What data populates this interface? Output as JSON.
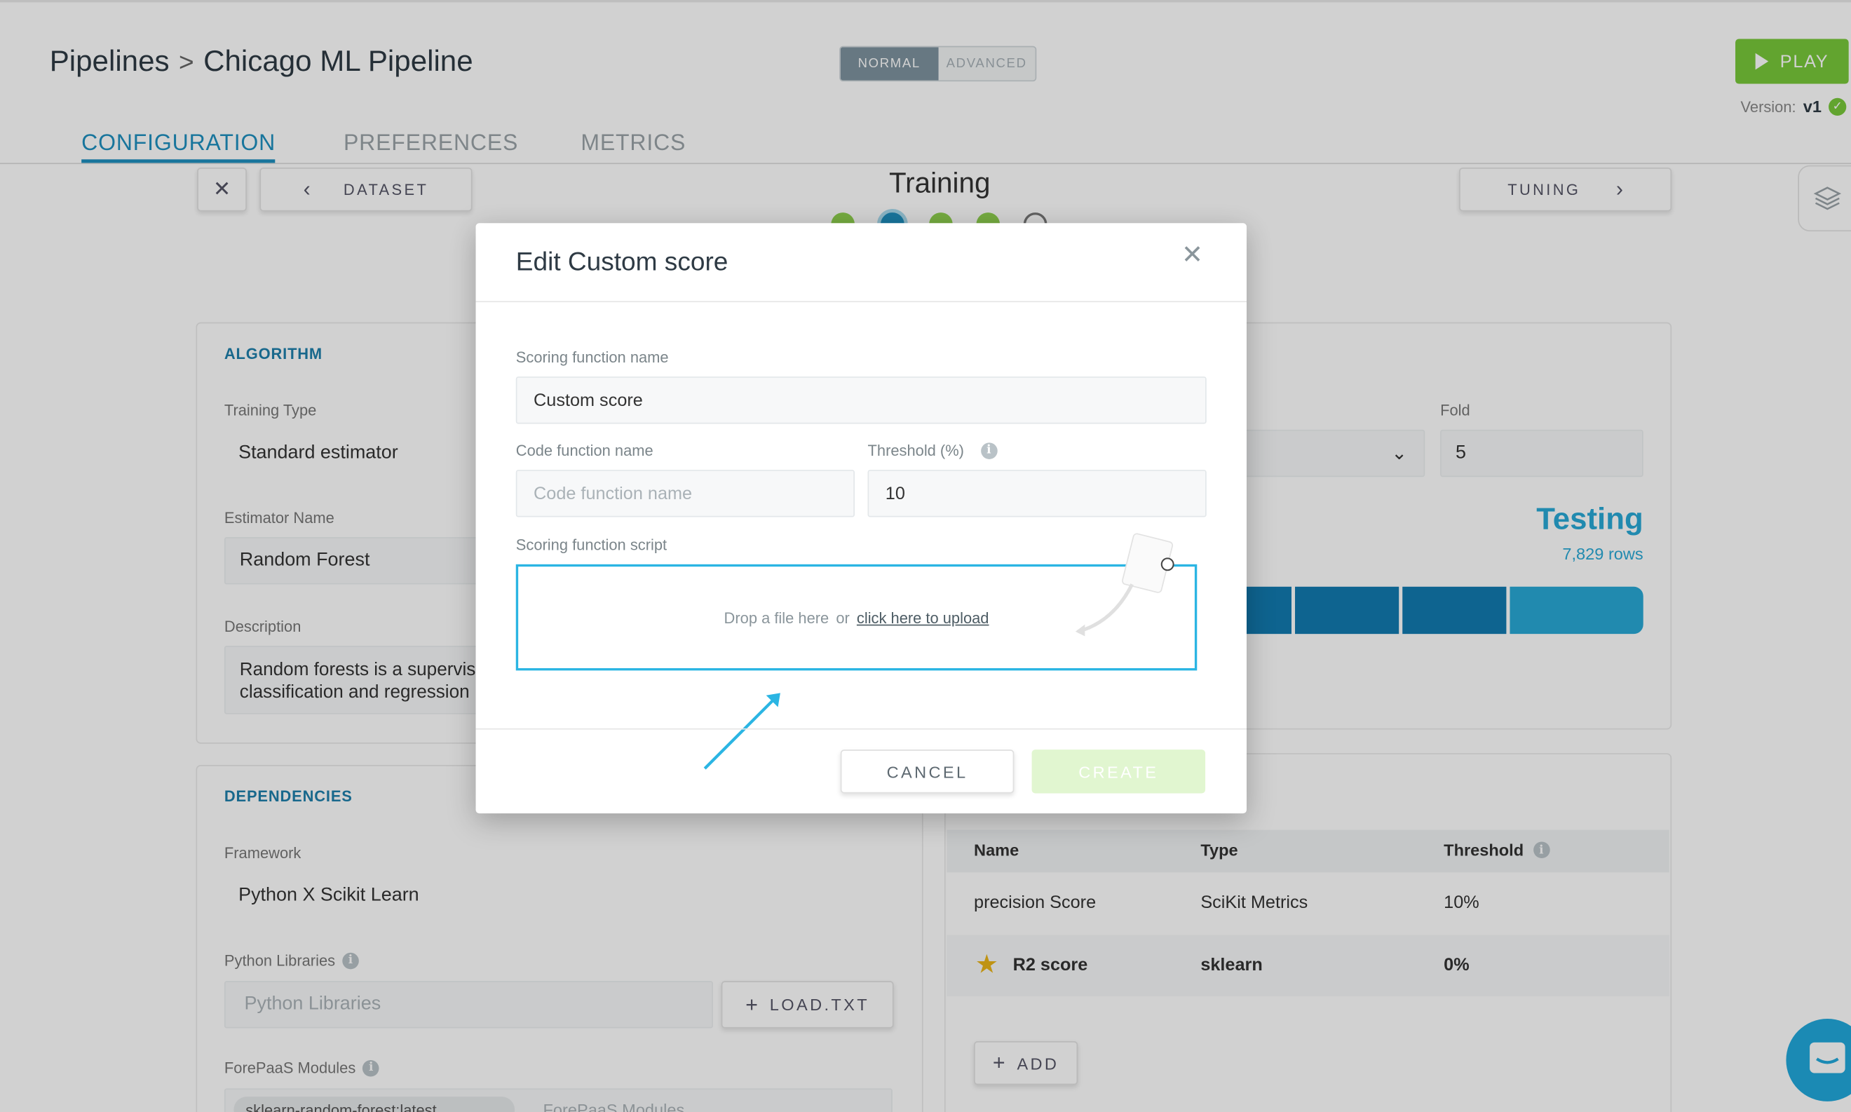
{
  "header": {
    "breadcrumb_root": "Pipelines",
    "breadcrumb_separator": ">",
    "breadcrumb_current": "Chicago ML Pipeline",
    "mode_normal": "NORMAL",
    "mode_advanced": "ADVANCED",
    "play_label": "PLAY",
    "version_label": "Version:",
    "version_value": "v1"
  },
  "tabs": [
    {
      "label": "CONFIGURATION",
      "active": true
    },
    {
      "label": "PREFERENCES",
      "active": false
    },
    {
      "label": "METRICS",
      "active": false
    }
  ],
  "steps": {
    "close_glyph": "✕",
    "prev_label": "DATASET",
    "current_title": "Training",
    "next_label": "TUNING"
  },
  "algorithm": {
    "title": "ALGORITHM",
    "training_type_label": "Training Type",
    "training_type_value": "Standard estimator",
    "estimator_label": "Estimator Name",
    "estimator_value": "Random Forest",
    "description_label": "Description",
    "description_value": "Random forests is a supervised learning algorithm. It can be used both for classification and regression"
  },
  "split": {
    "fold_label": "Fold",
    "fold_value": "5",
    "testing_title": "Testing",
    "testing_rows": "7,829 rows"
  },
  "dependencies": {
    "title": "DEPENDENCIES",
    "framework_label": "Framework",
    "framework_value": "Python X Scikit Learn",
    "python_libraries_label": "Python Libraries",
    "python_libraries_placeholder": "Python Libraries",
    "load_txt_label": "LOAD.TXT",
    "modules_label": "ForePaaS Modules",
    "modules_chip": "sklearn-random-forest:latest",
    "modules_placeholder": "ForePaaS Modules"
  },
  "scores_table": {
    "columns": [
      "Name",
      "Type",
      "Threshold"
    ],
    "rows": [
      {
        "name": "precision Score",
        "type": "SciKit Metrics",
        "threshold": "10%",
        "starred": false
      },
      {
        "name": "R2 score",
        "type": "sklearn",
        "threshold": "0%",
        "starred": true
      }
    ],
    "add_label": "ADD"
  },
  "modal": {
    "title": "Edit Custom score",
    "scoring_name_label": "Scoring function name",
    "scoring_name_value": "Custom score",
    "code_name_label": "Code function name",
    "code_name_placeholder": "Code function name",
    "threshold_label": "Threshold (%)",
    "threshold_value": "10",
    "script_label": "Scoring function script",
    "drop_text": "Drop a file here",
    "drop_or": "or",
    "drop_link": "click here to upload",
    "cancel_label": "CANCEL",
    "create_label": "CREATE"
  },
  "icons": {
    "close": "close-icon",
    "chevron_left": "chevron-left-icon",
    "chevron_right": "chevron-right-icon",
    "chevron_down": "chevron-down-icon",
    "info": "info-icon",
    "star": "star-icon",
    "plus": "plus-icon",
    "play": "play-icon",
    "check": "check-circle-icon",
    "layers": "layers-icon",
    "chat": "chat-icon"
  },
  "colors": {
    "accent": "#1e8fbf",
    "play_green": "#78c93a",
    "drop_border": "#2bb5e3",
    "create_disabled": "#e1f6d0",
    "bar_blue": "#127ab0",
    "testing_blue": "#29a9d6"
  }
}
